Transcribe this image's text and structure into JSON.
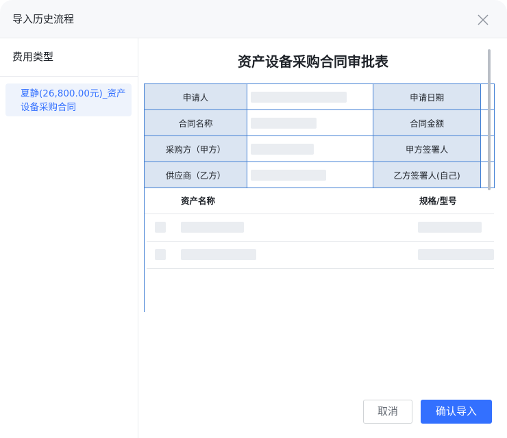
{
  "dialog": {
    "title": "导入历史流程",
    "close_icon": "close-icon"
  },
  "sidebar": {
    "title": "费用类型",
    "items": [
      {
        "label": "夏静(26,800.00元)_资产设备采购合同",
        "selected": true
      }
    ]
  },
  "preview": {
    "title": "资产设备采购合同审批表",
    "fields": [
      {
        "left": "申请人",
        "right": "申请日期"
      },
      {
        "left": "合同名称",
        "right": "合同金额"
      },
      {
        "left": "采购方（甲方）",
        "right": "甲方签署人"
      },
      {
        "left": "供应商（乙方）",
        "right": "乙方签署人(自己)"
      }
    ],
    "asset_columns": [
      "资产名称",
      "规格/型号"
    ]
  },
  "actions": {
    "cancel": "取消",
    "confirm": "确认导入"
  },
  "colors": {
    "accent": "#3370ff",
    "table_border": "#3f7ed4",
    "label_bg": "#dbe5f2",
    "selected_bg": "#eef3fc"
  }
}
